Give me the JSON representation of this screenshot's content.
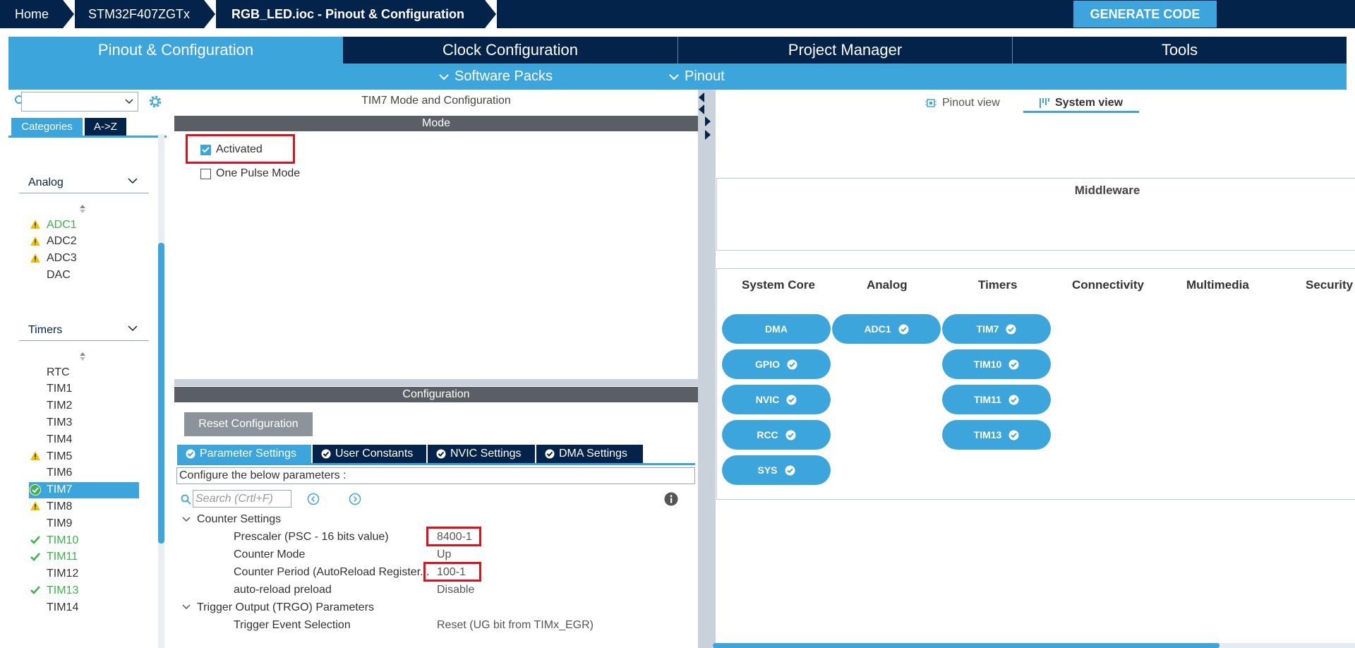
{
  "breadcrumb": [
    "Home",
    "STM32F407ZGTx",
    "RGB_LED.ioc - Pinout & Configuration"
  ],
  "generate_code": "GENERATE CODE",
  "main_tabs": [
    "Pinout & Configuration",
    "Clock Configuration",
    "Project Manager",
    "Tools"
  ],
  "sub_menu": [
    "Software Packs",
    "Pinout"
  ],
  "sidebar": {
    "search_value": "",
    "tabs": [
      "Categories",
      "A->Z"
    ],
    "groups": [
      {
        "label": "Analog",
        "items": [
          {
            "label": "ADC1",
            "status": "warning",
            "green": true
          },
          {
            "label": "ADC2",
            "status": "warning",
            "green": false
          },
          {
            "label": "ADC3",
            "status": "warning",
            "green": false
          },
          {
            "label": "DAC",
            "status": "none",
            "green": false
          }
        ]
      },
      {
        "label": "Timers",
        "items": [
          {
            "label": "RTC",
            "status": "none",
            "green": false
          },
          {
            "label": "TIM1",
            "status": "none",
            "green": false
          },
          {
            "label": "TIM2",
            "status": "none",
            "green": false
          },
          {
            "label": "TIM3",
            "status": "none",
            "green": false
          },
          {
            "label": "TIM4",
            "status": "none",
            "green": false
          },
          {
            "label": "TIM5",
            "status": "warning",
            "green": false
          },
          {
            "label": "TIM6",
            "status": "none",
            "green": false
          },
          {
            "label": "TIM7",
            "status": "ok-selected",
            "green": false
          },
          {
            "label": "TIM8",
            "status": "warning",
            "green": false
          },
          {
            "label": "TIM9",
            "status": "none",
            "green": false
          },
          {
            "label": "TIM10",
            "status": "ok",
            "green": true
          },
          {
            "label": "TIM11",
            "status": "ok",
            "green": true
          },
          {
            "label": "TIM12",
            "status": "none",
            "green": false
          },
          {
            "label": "TIM13",
            "status": "ok",
            "green": true
          },
          {
            "label": "TIM14",
            "status": "none",
            "green": false
          }
        ]
      }
    ]
  },
  "mode_panel": {
    "title": "TIM7 Mode and Configuration",
    "header": "Mode",
    "activated_label": "Activated",
    "activated": true,
    "one_pulse_label": "One Pulse Mode",
    "one_pulse": false
  },
  "config_panel": {
    "header": "Configuration",
    "reset_label": "Reset Configuration",
    "tabs": [
      "Parameter Settings",
      "User Constants",
      "NVIC Settings",
      "DMA Settings"
    ],
    "note": "Configure the below parameters :",
    "search_placeholder": "Search (Crtl+F)",
    "groups": [
      {
        "label": "Counter Settings",
        "params": [
          {
            "name": "Prescaler (PSC - 16 bits value)",
            "value": "8400-1"
          },
          {
            "name": "Counter Mode",
            "value": "Up"
          },
          {
            "name": "Counter Period (AutoReload Register...",
            "value": "100-1"
          },
          {
            "name": "auto-reload preload",
            "value": "Disable"
          }
        ]
      },
      {
        "label": "Trigger Output (TRGO) Parameters",
        "params": [
          {
            "name": "Trigger Event Selection",
            "value": "Reset (UG bit from TIMx_EGR)"
          }
        ]
      }
    ]
  },
  "right_panel": {
    "view_tabs": [
      "Pinout view",
      "System view"
    ],
    "active_view": "System view",
    "middleware_title": "Middleware",
    "columns": [
      "System Core",
      "Analog",
      "Timers",
      "Connectivity",
      "Multimedia",
      "Security"
    ],
    "system_core": [
      "DMA",
      "GPIO",
      "NVIC",
      "RCC",
      "SYS"
    ],
    "analog": [
      "ADC1"
    ],
    "timers": [
      "TIM7",
      "TIM10",
      "TIM11",
      "TIM13"
    ]
  },
  "colors": {
    "navy": "#03234b",
    "accent": "#3ca6dc",
    "warning": "#f2c200",
    "ok": "#3bb34a",
    "highlight": "#e0101d"
  }
}
